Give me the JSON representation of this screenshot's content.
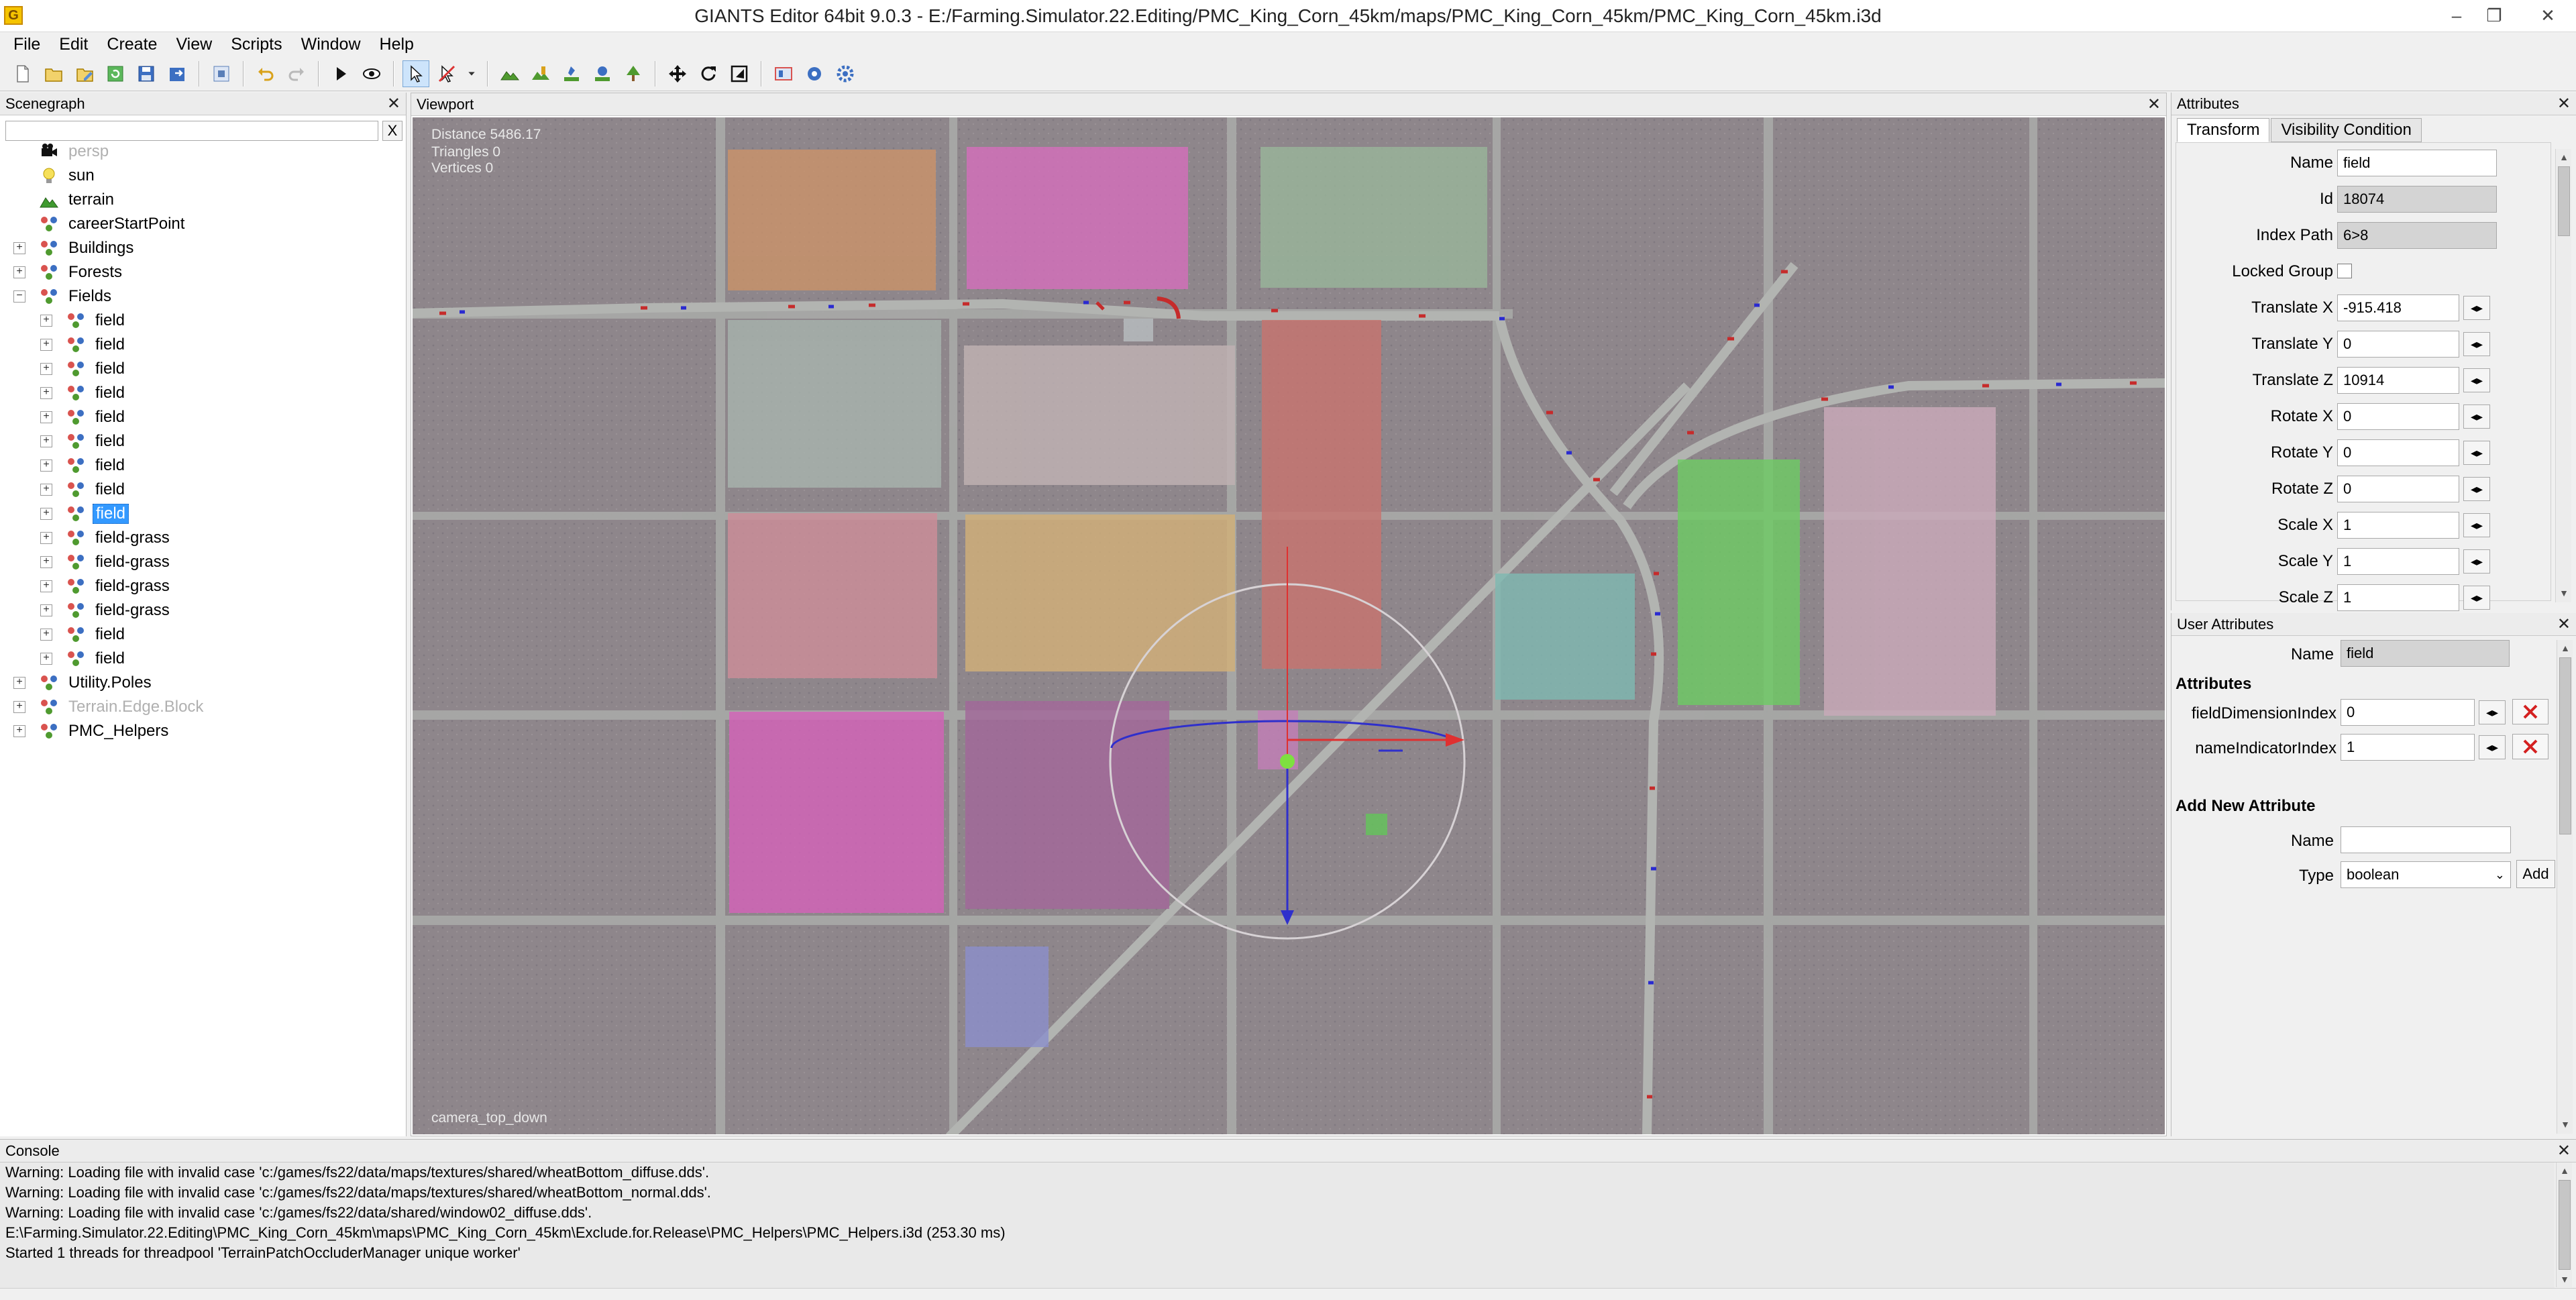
{
  "window": {
    "app_icon": "G",
    "title": "GIANTS Editor 64bit 9.0.3 - E:/Farming.Simulator.22.Editing/PMC_King_Corn_45km/maps/PMC_King_Corn_45km/PMC_King_Corn_45km.i3d",
    "minimize": "–",
    "restore": "❐",
    "close": "✕"
  },
  "menu": [
    "File",
    "Edit",
    "Create",
    "View",
    "Scripts",
    "Window",
    "Help"
  ],
  "toolbar": {
    "buttons": [
      "new-icon",
      "open-icon",
      "edit-icon",
      "reload-icon",
      "save-icon",
      "export-icon",
      "import-icon",
      "undo-icon",
      "redo-icon",
      "play-icon",
      "eye-icon",
      "select-icon",
      "no-select-icon",
      "dropdown-icon",
      "terrain-icon",
      "paint-icon",
      "brush-icon",
      "foliage-icon",
      "tree-icon",
      "move-icon",
      "rotate-icon",
      "scale-icon",
      "camera-icon",
      "settings-icon",
      "gear-icon"
    ]
  },
  "scenegraph": {
    "title": "Scenegraph",
    "close": "✕",
    "filter_clear": "X",
    "items": [
      {
        "label": "persp",
        "icon": "camera",
        "depth": 0,
        "expandable": false,
        "dim": true
      },
      {
        "label": "sun",
        "icon": "light",
        "depth": 0,
        "expandable": false
      },
      {
        "label": "terrain",
        "icon": "terrain",
        "depth": 0,
        "expandable": false
      },
      {
        "label": "careerStartPoint",
        "icon": "transform",
        "depth": 0,
        "expandable": false
      },
      {
        "label": "Buildings",
        "icon": "transform",
        "depth": 0,
        "expandable": true
      },
      {
        "label": "Forests",
        "icon": "transform",
        "depth": 0,
        "expandable": true
      },
      {
        "label": "Fields",
        "icon": "transform",
        "depth": 0,
        "expandable": true,
        "expanded": true
      },
      {
        "label": "field",
        "icon": "transform",
        "depth": 1,
        "expandable": true
      },
      {
        "label": "field",
        "icon": "transform",
        "depth": 1,
        "expandable": true
      },
      {
        "label": "field",
        "icon": "transform",
        "depth": 1,
        "expandable": true
      },
      {
        "label": "field",
        "icon": "transform",
        "depth": 1,
        "expandable": true
      },
      {
        "label": "field",
        "icon": "transform",
        "depth": 1,
        "expandable": true
      },
      {
        "label": "field",
        "icon": "transform",
        "depth": 1,
        "expandable": true
      },
      {
        "label": "field",
        "icon": "transform",
        "depth": 1,
        "expandable": true
      },
      {
        "label": "field",
        "icon": "transform",
        "depth": 1,
        "expandable": true
      },
      {
        "label": "field",
        "icon": "transform",
        "depth": 1,
        "expandable": true,
        "selected": true
      },
      {
        "label": "field-grass",
        "icon": "transform",
        "depth": 1,
        "expandable": true
      },
      {
        "label": "field-grass",
        "icon": "transform",
        "depth": 1,
        "expandable": true
      },
      {
        "label": "field-grass",
        "icon": "transform",
        "depth": 1,
        "expandable": true
      },
      {
        "label": "field-grass",
        "icon": "transform",
        "depth": 1,
        "expandable": true
      },
      {
        "label": "field",
        "icon": "transform",
        "depth": 1,
        "expandable": true
      },
      {
        "label": "field",
        "icon": "transform",
        "depth": 1,
        "expandable": true
      },
      {
        "label": "Utility.Poles",
        "icon": "transform",
        "depth": 0,
        "expandable": true
      },
      {
        "label": "Terrain.Edge.Block",
        "icon": "transform",
        "depth": 0,
        "expandable": true,
        "dim": true
      },
      {
        "label": "PMC_Helpers",
        "icon": "transform",
        "depth": 0,
        "expandable": true
      }
    ]
  },
  "viewport": {
    "title": "Viewport",
    "close": "✕",
    "distance": "Distance 5486.17",
    "triangles": "Triangles 0",
    "vertices": "Vertices 0",
    "camera": "camera_top_down"
  },
  "attributes": {
    "title": "Attributes",
    "close": "✕",
    "tabs": [
      "Transform",
      "Visibility Condition"
    ],
    "rows": [
      {
        "label": "Name",
        "value": "field",
        "type": "text"
      },
      {
        "label": "Id",
        "value": "18074",
        "type": "readonly"
      },
      {
        "label": "Index Path",
        "value": "6>8",
        "type": "readonly"
      },
      {
        "label": "Locked Group",
        "value": "",
        "type": "checkbox"
      },
      {
        "label": "Translate X",
        "value": "-915.418",
        "type": "number"
      },
      {
        "label": "Translate Y",
        "value": "0",
        "type": "number"
      },
      {
        "label": "Translate Z",
        "value": "10914",
        "type": "number"
      },
      {
        "label": "Rotate X",
        "value": "0",
        "type": "number"
      },
      {
        "label": "Rotate Y",
        "value": "0",
        "type": "number"
      },
      {
        "label": "Rotate Z",
        "value": "0",
        "type": "number"
      },
      {
        "label": "Scale X",
        "value": "1",
        "type": "number"
      },
      {
        "label": "Scale Y",
        "value": "1",
        "type": "number"
      },
      {
        "label": "Scale Z",
        "value": "1",
        "type": "number"
      }
    ],
    "arrows": "◂▸"
  },
  "user_attributes": {
    "title": "User Attributes",
    "close": "✕",
    "name_label": "Name",
    "name_value": "field",
    "section_label": "Attributes",
    "attrs": [
      {
        "label": "fieldDimensionIndex",
        "value": "0"
      },
      {
        "label": "nameIndicatorIndex",
        "value": "1"
      }
    ],
    "add_new_label": "Add New Attribute",
    "new_name_label": "Name",
    "new_name_value": "",
    "type_label": "Type",
    "type_value": "boolean",
    "add_button": "Add",
    "arrows": "◂▸"
  },
  "console": {
    "title": "Console",
    "close": "✕",
    "lines": [
      "Warning: Loading file with invalid case 'c:/games/fs22/data/maps/textures/shared/wheatBottom_diffuse.dds'.",
      "Warning: Loading file with invalid case 'c:/games/fs22/data/maps/textures/shared/wheatBottom_normal.dds'.",
      "Warning: Loading file with invalid case 'c:/games/fs22/data/shared/window02_diffuse.dds'.",
      "E:\\Farming.Simulator.22.Editing\\PMC_King_Corn_45km\\maps\\PMC_King_Corn_45km\\Exclude.for.Release\\PMC_Helpers\\PMC_Helpers.i3d (253.30 ms)",
      "Started 1 threads for threadpool 'TerrainPatchOccluderManager unique worker'"
    ]
  },
  "colors": {
    "selection": "#3399ff",
    "ground": "#8f878c",
    "road": "#a7a9a6",
    "gizmo_x": "#e03030",
    "gizmo_y": "#2020e0",
    "gizmo_z": "#7ee040"
  }
}
